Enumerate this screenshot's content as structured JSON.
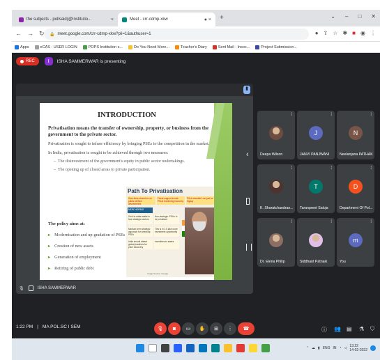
{
  "browser": {
    "tabs": [
      {
        "title": "the subjects - pollsaid(@Institutio...",
        "color": "#8e24aa"
      },
      {
        "title": "Meet - crr-cdmp-xkw",
        "color": "#00897b"
      }
    ],
    "new_tab": "+",
    "url": "meet.google.com/crr-cdmp-xkw?pli=1&authuser=1",
    "bookmarks": [
      {
        "label": "Apps",
        "color": "#1a73e8"
      },
      {
        "label": "eCAS - USER LOGIN",
        "color": "#9e9e9e"
      },
      {
        "label": "POPS Institution s...",
        "color": "#43a047"
      },
      {
        "label": "Do You Need More...",
        "color": "#fbc02d"
      },
      {
        "label": "Teacher's Diary",
        "color": "#fb8c00"
      },
      {
        "label": "Sent Mail - Insoc...",
        "color": "#d93025"
      },
      {
        "label": "Project Submission...",
        "color": "#3949ab"
      }
    ]
  },
  "meet": {
    "rec_label": "REC",
    "presenter_initial": "I",
    "presenting_text": "ISHA SAMMERWAR is presenting",
    "stage_name": "ISHA SAMMERWAR",
    "meeting_time": "1:22 PM",
    "meeting_sep": "|",
    "meeting_code": "MA POL.SC I SEM"
  },
  "slide": {
    "title": "INTRODUCTION",
    "lead": "Privatisation means the transfer of ownership, property, or business from the government to the private sector.",
    "p1": "Privatisation is sought to infuse efficiency by bringing PSEs to the competition in the market.",
    "p2": "In India, privatisation is sought to be achieved through two measures:",
    "bullets": [
      "The disinvestment of the government's equity in public sector undertakings.",
      "The opening up of closed areas to private participation."
    ],
    "aims_heading": "The policy aims at:",
    "aims": [
      "Modernisation and up-gradation of PSEs",
      "Creation of new assets",
      "Generation of employment",
      "Retiring of public debt"
    ],
    "infographic": {
      "title": "Path To Privatisation",
      "top": [
        "Govt firms should be on public welfare development",
        "Fiscal support to sick PSUs burdening economy",
        "PSUs shouldn't run just for legacy"
      ],
      "new_heading": "NEW NORMS",
      "cells": [
        "Govt to retain stake in four strategic sectors",
        "Non-strategic: PSUs to be privatised",
        "Incentives to states",
        "Medium term strategic approach for selecting PSEs",
        "This is in 2.5 lakh crore investment opportunity",
        "India should attract global practices for price discovery"
      ],
      "source": "Image Source: Google"
    }
  },
  "participants": [
    {
      "name": "Deepa Wilson",
      "initial": "",
      "color": "#6d4c41",
      "photo": true
    },
    {
      "name": "JANVI PANJWANI",
      "initial": "J",
      "color": "#5c6bc0",
      "photo": false
    },
    {
      "name": "Neelanjana PATHAK",
      "initial": "N",
      "color": "#795548",
      "photo": false
    },
    {
      "name": "K. Sharatchandran...",
      "initial": "",
      "color": "#4e342e",
      "photo": true
    },
    {
      "name": "Taranpreet Saluja",
      "initial": "T",
      "color": "#00796b",
      "photo": false
    },
    {
      "name": "Department Of Pol...",
      "initial": "D",
      "color": "#f4511e",
      "photo": false
    },
    {
      "name": "Dr. Elena Philip",
      "initial": "",
      "color": "#8d6e63",
      "photo": true
    },
    {
      "name": "Siddhant Patnaik",
      "initial": "",
      "color": "#e1bee7",
      "photo": true
    },
    {
      "name": "You",
      "initial": "m",
      "color": "#5c6bc0",
      "photo": false
    }
  ],
  "controls": {
    "colors": {
      "danger": "#ea4335",
      "neutral": "#3c4043",
      "accent": "#8ab4f8"
    }
  },
  "taskbar": {
    "lang": "ENG",
    "region": "IN",
    "time": "13:22",
    "date": "14-02-2022"
  }
}
